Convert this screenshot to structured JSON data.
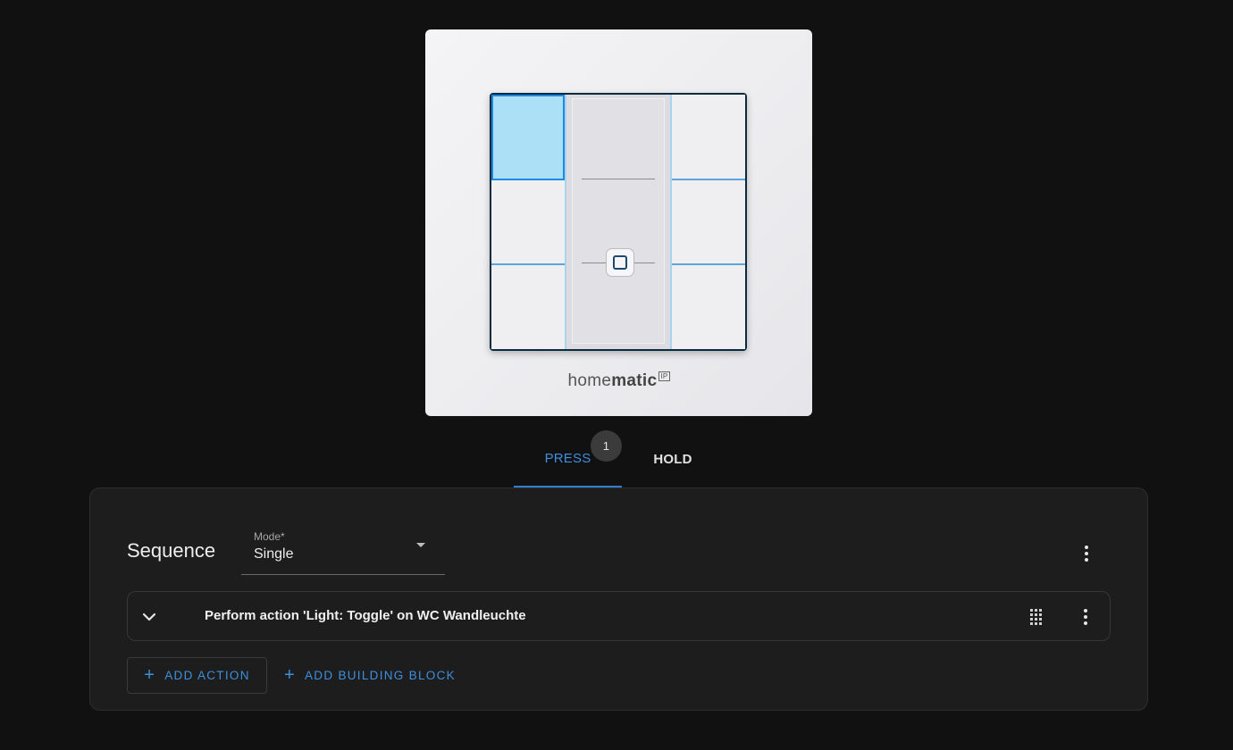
{
  "device": {
    "brand_regular": "home",
    "brand_bold": "matic",
    "brand_badge": "IP"
  },
  "tabs": [
    {
      "label": "PRESS",
      "badge": "1",
      "active": true
    },
    {
      "label": "HOLD",
      "active": false
    }
  ],
  "sequence": {
    "title": "Sequence",
    "mode_label": "Mode*",
    "mode_value": "Single"
  },
  "actions": [
    {
      "text": "Perform action 'Light: Toggle' on WC Wandleuchte"
    }
  ],
  "buttons": {
    "add_action": "ADD ACTION",
    "add_building_block": "ADD BUILDING BLOCK"
  },
  "colors": {
    "accent": "#3d8fe0",
    "background": "#111111",
    "card": "#1d1d1d",
    "active_rocker": "#ace0f6"
  }
}
